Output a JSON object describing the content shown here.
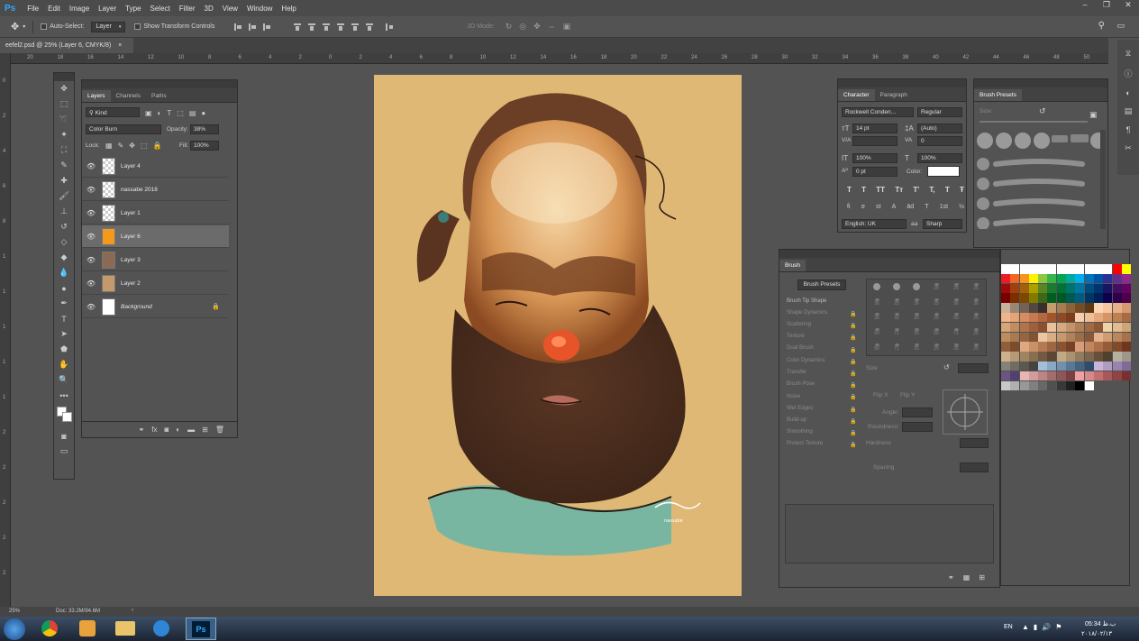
{
  "app": {
    "logo": "Ps",
    "menu": [
      "File",
      "Edit",
      "Image",
      "Layer",
      "Type",
      "Select",
      "Filter",
      "3D",
      "View",
      "Window",
      "Help"
    ]
  },
  "options": {
    "auto_select_label": "Auto-Select:",
    "auto_select_value": "Layer",
    "transform_label": "Show Transform Controls",
    "mode_3d_label": "3D Mode:"
  },
  "document": {
    "tab_title": "eefel2.psd @ 25% (Layer 6, CMYK/8)",
    "tab_close": "×"
  },
  "rulers": {
    "h": [
      "20",
      "18",
      "16",
      "14",
      "12",
      "10",
      "8",
      "6",
      "4",
      "2",
      "0",
      "2",
      "4",
      "6",
      "8",
      "10",
      "12",
      "14",
      "16",
      "18",
      "20",
      "22",
      "24",
      "26",
      "28",
      "30",
      "32",
      "34",
      "36",
      "38",
      "40",
      "42",
      "44",
      "46",
      "48",
      "50"
    ],
    "v": [
      "0",
      "2",
      "4",
      "6",
      "8",
      "1",
      "1",
      "1",
      "1",
      "1",
      "2",
      "2",
      "2",
      "2",
      "2"
    ]
  },
  "layers_panel": {
    "tabs": [
      "Layers",
      "Channels",
      "Paths"
    ],
    "kind_label": "Kind",
    "blend_mode": "Color Burn",
    "opacity_label": "Opacity:",
    "opacity_value": "38%",
    "lock_label": "Lock:",
    "fill_label": "Fill:",
    "fill_value": "100%",
    "layers": [
      {
        "name": "Layer 4",
        "thumb": "checker",
        "selected": false
      },
      {
        "name": "nassabe 2018",
        "thumb": "checker",
        "selected": false
      },
      {
        "name": "Layer 1",
        "thumb": "checker",
        "selected": false
      },
      {
        "name": "Layer 6",
        "thumb": "#f39a1d",
        "selected": true
      },
      {
        "name": "Layer 3",
        "thumb": "#8a6a55",
        "selected": false
      },
      {
        "name": "Layer 2",
        "thumb": "#c49a6c",
        "selected": false
      },
      {
        "name": "Background",
        "thumb": "#ffffff",
        "selected": false
      }
    ],
    "footer_icons": [
      "link-icon",
      "fx-icon",
      "mask-icon",
      "adjustment-icon",
      "folder-icon",
      "new-layer-icon",
      "trash-icon"
    ]
  },
  "character_panel": {
    "tabs": [
      "Character",
      "Paragraph"
    ],
    "font_family": "Rockwell Conden...",
    "font_style": "Regular",
    "font_size": "14 pt",
    "leading": "(Auto)",
    "tracking": "0",
    "vscale": "100%",
    "hscale": "100%",
    "baseline": "0 pt",
    "color_label": "Color:",
    "text_buttons": [
      "T",
      "T",
      "TT",
      "Tт",
      "T'",
      "T,",
      "T",
      "Ŧ"
    ],
    "opentype_buttons": [
      "fi",
      "σ",
      "st",
      "A",
      "ād",
      "T",
      "1st",
      "½"
    ],
    "language": "English: UK",
    "aa_label": "aa",
    "antialias": "Sharp"
  },
  "brush_presets_panel": {
    "title": "Brush Presets",
    "size_label": "Size:"
  },
  "brush_panel": {
    "tab": "Brush",
    "presets_button": "Brush Presets",
    "options": [
      "Brush Tip Shape",
      "Shape Dynamics",
      "Scattering",
      "Texture",
      "Dual Brush",
      "Color Dynamics",
      "Transfer",
      "Brush Pose",
      "Noise",
      "Wet Edges",
      "Build-up",
      "Smoothing",
      "Protect Texture"
    ],
    "size_label": "Size",
    "flip_x": "Flip X",
    "flip_y": "Flip Y",
    "angle_label": "Angle:",
    "roundness_label": "Roundness:",
    "hardness_label": "Hardness",
    "spacing_label": "Spacing",
    "tip_sizes": [
      "",
      "",
      "",
      "25",
      "25",
      "25",
      "36",
      "25",
      "36",
      "25",
      "36",
      "36",
      "36",
      "32",
      "25",
      "25",
      "50",
      "25",
      "50",
      "71",
      "25",
      "50",
      "71",
      "25",
      "50",
      "71",
      "25",
      "25",
      "25",
      "25"
    ]
  },
  "status": {
    "zoom": "25%",
    "doc": "Doc: 33.2M/94.6M"
  },
  "taskbar": {
    "lang": "EN",
    "time": "05:34 ب.ظ",
    "date": "۲۰۱۸/۰۲/۱۳"
  },
  "colors": {
    "canvas": "#dfb875",
    "panel": "#535353",
    "dark": "#424242",
    "selected_layer": "#6b6b6b"
  }
}
